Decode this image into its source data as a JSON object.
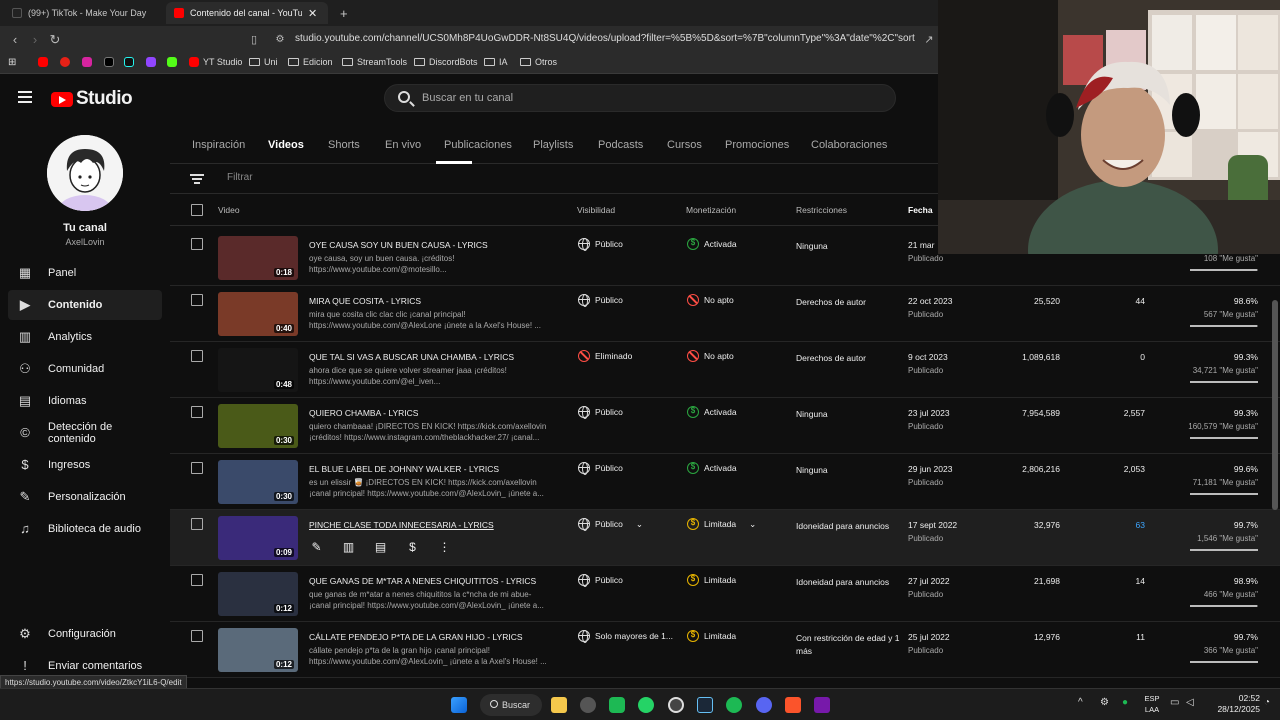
{
  "browser": {
    "tabs": [
      {
        "label": "(99+) TikTok - Make Your Day",
        "active": false
      },
      {
        "label": "Contenido del canal - YouTube S",
        "active": true
      }
    ],
    "url": "studio.youtube.com/channel/UCS0Mh8P4UoGwDDR-Nt8SU4Q/videos/upload?filter=%5B%5D&sort=%7B\"columnType\"%3A\"date\"%2C\"sortOrder\"%...",
    "bookmarks": [
      "YT Studio",
      "Uni",
      "Edicion",
      "StreamTools",
      "DiscordBots",
      "IA",
      "Otros"
    ],
    "status_url": "https://studio.youtube.com/video/ZtkcY1iL6-Q/edit"
  },
  "header": {
    "logo_text": "Studio",
    "search_placeholder": "Buscar en tu canal"
  },
  "sidebar": {
    "channel_label": "Tu canal",
    "channel_handle": "AxelLovin",
    "items": [
      {
        "label": "Panel",
        "icon": "dashboard-icon"
      },
      {
        "label": "Contenido",
        "icon": "content-icon",
        "selected": true
      },
      {
        "label": "Analytics",
        "icon": "analytics-icon"
      },
      {
        "label": "Comunidad",
        "icon": "community-icon"
      },
      {
        "label": "Idiomas",
        "icon": "subtitles-icon"
      },
      {
        "label": "Detección de contenido",
        "icon": "copyright-icon"
      },
      {
        "label": "Ingresos",
        "icon": "money-icon"
      },
      {
        "label": "Personalización",
        "icon": "customization-icon"
      },
      {
        "label": "Biblioteca de audio",
        "icon": "audio-library-icon"
      }
    ],
    "bottom": [
      {
        "label": "Configuración",
        "icon": "gear-icon"
      },
      {
        "label": "Enviar comentarios",
        "icon": "feedback-icon"
      }
    ]
  },
  "content_tabs": [
    "Inspiración",
    "Videos",
    "Shorts",
    "En vivo",
    "Publicaciones",
    "Playlists",
    "Podcasts",
    "Cursos",
    "Promociones",
    "Colaboraciones"
  ],
  "filter_placeholder": "Filtrar",
  "columns": {
    "video": "Video",
    "visibility": "Visibilidad",
    "monetization": "Monetización",
    "restrictions": "Restricciones",
    "date": "Fecha"
  },
  "rows": [
    {
      "title": "OYE CAUSA SOY UN BUEN CAUSA - LYRICS",
      "desc1": "oye causa, soy un buen causa. ¡créditos!",
      "desc2": "https://www.youtube.com/@motesillo...",
      "duration": "0:18",
      "visibility": "Público",
      "vis_icon": "globe",
      "monetization": "Activada",
      "mon_icon": "green",
      "restrictions": "Ninguna",
      "date": "21 mar",
      "status": "Publicado",
      "views": "",
      "comments": "",
      "likes_pct": "",
      "likes_count": "108 \"Me gusta\"",
      "likes_fill": 0.99,
      "thumb": "#5a2a2a"
    },
    {
      "title": "MIRA QUE COSITA - LYRICS",
      "desc1": "mira que cosita clic clac clic ¡canal principal!",
      "desc2": "https://www.youtube.com/@AlexLone ¡únete a la Axel's House! ...",
      "duration": "0:40",
      "visibility": "Público",
      "vis_icon": "globe",
      "monetization": "No apto",
      "mon_icon": "red",
      "restrictions": "Derechos de autor",
      "date": "22 oct 2023",
      "status": "Publicado",
      "views": "25,520",
      "comments": "44",
      "likes_pct": "98.6%",
      "likes_count": "567 \"Me gusta\"",
      "likes_fill": 0.986,
      "thumb": "#7a3a28"
    },
    {
      "title": "QUE TAL SI VAS A BUSCAR UNA CHAMBA - LYRICS",
      "desc1": "ahora dice que se quiere volver streamer jaaa ¡créditos!",
      "desc2": "https://www.youtube.com/@el_iven...",
      "duration": "0:48",
      "visibility": "Eliminado",
      "vis_icon": "red",
      "monetization": "No apto",
      "mon_icon": "red",
      "restrictions": "Derechos de autor",
      "date": "9 oct 2023",
      "status": "Publicado",
      "views": "1,089,618",
      "comments": "0",
      "likes_pct": "99.3%",
      "likes_count": "34,721 \"Me gusta\"",
      "likes_fill": 0.993,
      "thumb": "#151515"
    },
    {
      "title": "QUIERO CHAMBA - LYRICS",
      "desc1": "quiero chambaaa! ¡DIRECTOS EN KICK! https://kick.com/axellovin",
      "desc2": "¡créditos! https://www.instagram.com/theblackhacker.27/ ¡canal...",
      "duration": "0:30",
      "visibility": "Público",
      "vis_icon": "globe",
      "monetization": "Activada",
      "mon_icon": "green",
      "restrictions": "Ninguna",
      "date": "23 jul 2023",
      "status": "Publicado",
      "views": "7,954,589",
      "comments": "2,557",
      "likes_pct": "99.3%",
      "likes_count": "160,579 \"Me gusta\"",
      "likes_fill": 0.993,
      "thumb": "#4a5a18"
    },
    {
      "title": "EL BLUE LABEL DE JOHNNY WALKER - LYRICS",
      "desc1": "es un elissir 🥃 ¡DIRECTOS EN KICK! https://kick.com/axellovin",
      "desc2": "¡canal principal! https://www.youtube.com/@AlexLovin_ ¡únete a...",
      "duration": "0:30",
      "visibility": "Público",
      "vis_icon": "globe",
      "monetization": "Activada",
      "mon_icon": "green",
      "restrictions": "Ninguna",
      "date": "29 jun 2023",
      "status": "Publicado",
      "views": "2,806,216",
      "comments": "2,053",
      "likes_pct": "99.6%",
      "likes_count": "71,181 \"Me gusta\"",
      "likes_fill": 0.996,
      "thumb": "#3a4a6a"
    },
    {
      "title": "PINCHE CLASE TODA INNECESARIA - LYRICS",
      "desc1": "",
      "desc2": "",
      "duration": "0:09",
      "visibility": "Público",
      "vis_icon": "globe",
      "monetization": "Limitada",
      "mon_icon": "yellow",
      "restrictions": "Idoneidad para anuncios",
      "date": "17 sept 2022",
      "status": "Publicado",
      "views": "32,976",
      "comments": "63",
      "likes_pct": "99.7%",
      "likes_count": "1,546 \"Me gusta\"",
      "likes_fill": 0.997,
      "thumb": "#3a2a7a",
      "hovered": true
    },
    {
      "title": "QUE GANAS DE M*TAR A NENES CHIQUITITOS - LYRICS",
      "desc1": "que ganas de m*atar a nenes chiquititos la c*ncha de mi abue-",
      "desc2": "¡canal principal! https://www.youtube.com/@AlexLovin_ ¡únete a...",
      "duration": "0:12",
      "visibility": "Público",
      "vis_icon": "globe",
      "monetization": "Limitada",
      "mon_icon": "yellow",
      "restrictions": "Idoneidad para anuncios",
      "date": "27 jul 2022",
      "status": "Publicado",
      "views": "21,698",
      "comments": "14",
      "likes_pct": "98.9%",
      "likes_count": "466 \"Me gusta\"",
      "likes_fill": 0.989,
      "thumb": "#2a3040"
    },
    {
      "title": "CÁLLATE PENDEJO P*TA DE LA GRAN HIJO - LYRICS",
      "desc1": "cállate pendejo p*ta de la gran hijo ¡canal principal!",
      "desc2": "https://www.youtube.com/@AlexLovin_ ¡únete a la Axel's House! ...",
      "duration": "0:12",
      "visibility": "Solo mayores de 1...",
      "vis_icon": "globe",
      "monetization": "Limitada",
      "mon_icon": "yellow",
      "restrictions": "Con restricción de edad y 1 más",
      "date": "25 jul 2022",
      "status": "Publicado",
      "views": "12,976",
      "comments": "11",
      "likes_pct": "99.7%",
      "likes_count": "366 \"Me gusta\"",
      "likes_fill": 0.997,
      "thumb": "#5a6a7a"
    }
  ],
  "taskbar": {
    "search_label": "Buscar",
    "lang1": "ESP",
    "lang2": "LAA",
    "time": "02:52",
    "date": "28/12/2025"
  }
}
